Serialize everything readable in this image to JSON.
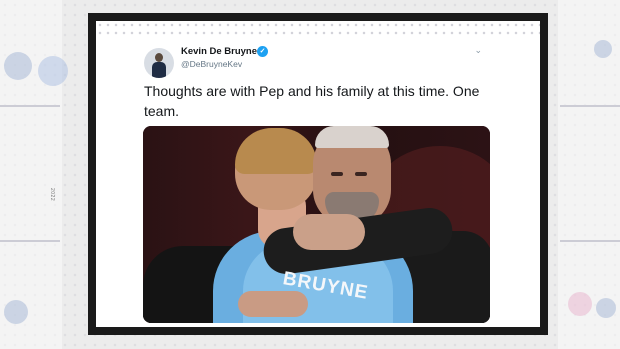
{
  "tweet": {
    "author_name": "Kevin De Bruyne",
    "handle": "@DeBruyneKev",
    "text": "Thoughts are with Pep and his family at this time. One team.",
    "verified_mark": "✓",
    "menu_glyph": "⌄"
  },
  "media": {
    "jersey_text": "BRUYNE"
  },
  "sidebar": {
    "vertical_text": "2022"
  },
  "colors": {
    "verified_blue": "#1da1f2",
    "frame": "#1a1a1a",
    "card": "#ffffff"
  }
}
